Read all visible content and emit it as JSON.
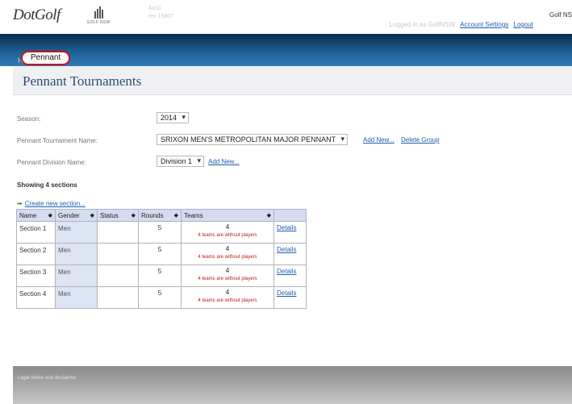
{
  "header": {
    "logo_text": "DotGolf",
    "partner_logo_text": "GOLF NSW",
    "app_name": "Aus1",
    "version": "rev 15807",
    "logged_in_text": "Logged in as GolfNSW",
    "account_settings": "Account Settings",
    "logout": "Logout",
    "org_name": "Golf NS"
  },
  "breadcrumb": {
    "home": "Home",
    "current": "Pennant"
  },
  "page_title": "Pennant Tournaments",
  "filters": {
    "season_label": "Season:",
    "season_value": "2014",
    "tournament_label": "Pennant Tournament Name:",
    "tournament_value": "SRIXON MEN'S METROPOLITAN MAJOR PENNANT",
    "add_new": "Add New...",
    "delete_group": "Delete Group",
    "division_label": "Pennant Division Name:",
    "division_value": "Division 1",
    "division_add_new": "Add New..."
  },
  "showing_text": "Showing 4 sections",
  "create_section": "Create new section...",
  "table": {
    "headers": [
      "Name",
      "Gender",
      "Status",
      "Rounds",
      "Teams",
      ""
    ],
    "rows": [
      {
        "name": "Section 1",
        "gender": "Men",
        "status": "",
        "rounds": "5",
        "teams": "4",
        "warning": "4 teams are without players",
        "action": "Details"
      },
      {
        "name": "Section 2",
        "gender": "Men",
        "status": "",
        "rounds": "5",
        "teams": "4",
        "warning": "4 teams are without players",
        "action": "Details"
      },
      {
        "name": "Section 3",
        "gender": "Men",
        "status": "",
        "rounds": "5",
        "teams": "4",
        "warning": "4 teams are without players",
        "action": "Details"
      },
      {
        "name": "Section 4",
        "gender": "Men",
        "status": "",
        "rounds": "5",
        "teams": "4",
        "warning": "4 teams are without players",
        "action": "Details"
      }
    ]
  },
  "footer": {
    "legal": "Legal notice and disclaimer"
  },
  "colors": {
    "nav_dark": "#0a2a4a",
    "nav_light": "#2f7bb6",
    "highlight_ring": "#d21010",
    "link": "#1f5fa8",
    "warning": "#c01a1a"
  }
}
